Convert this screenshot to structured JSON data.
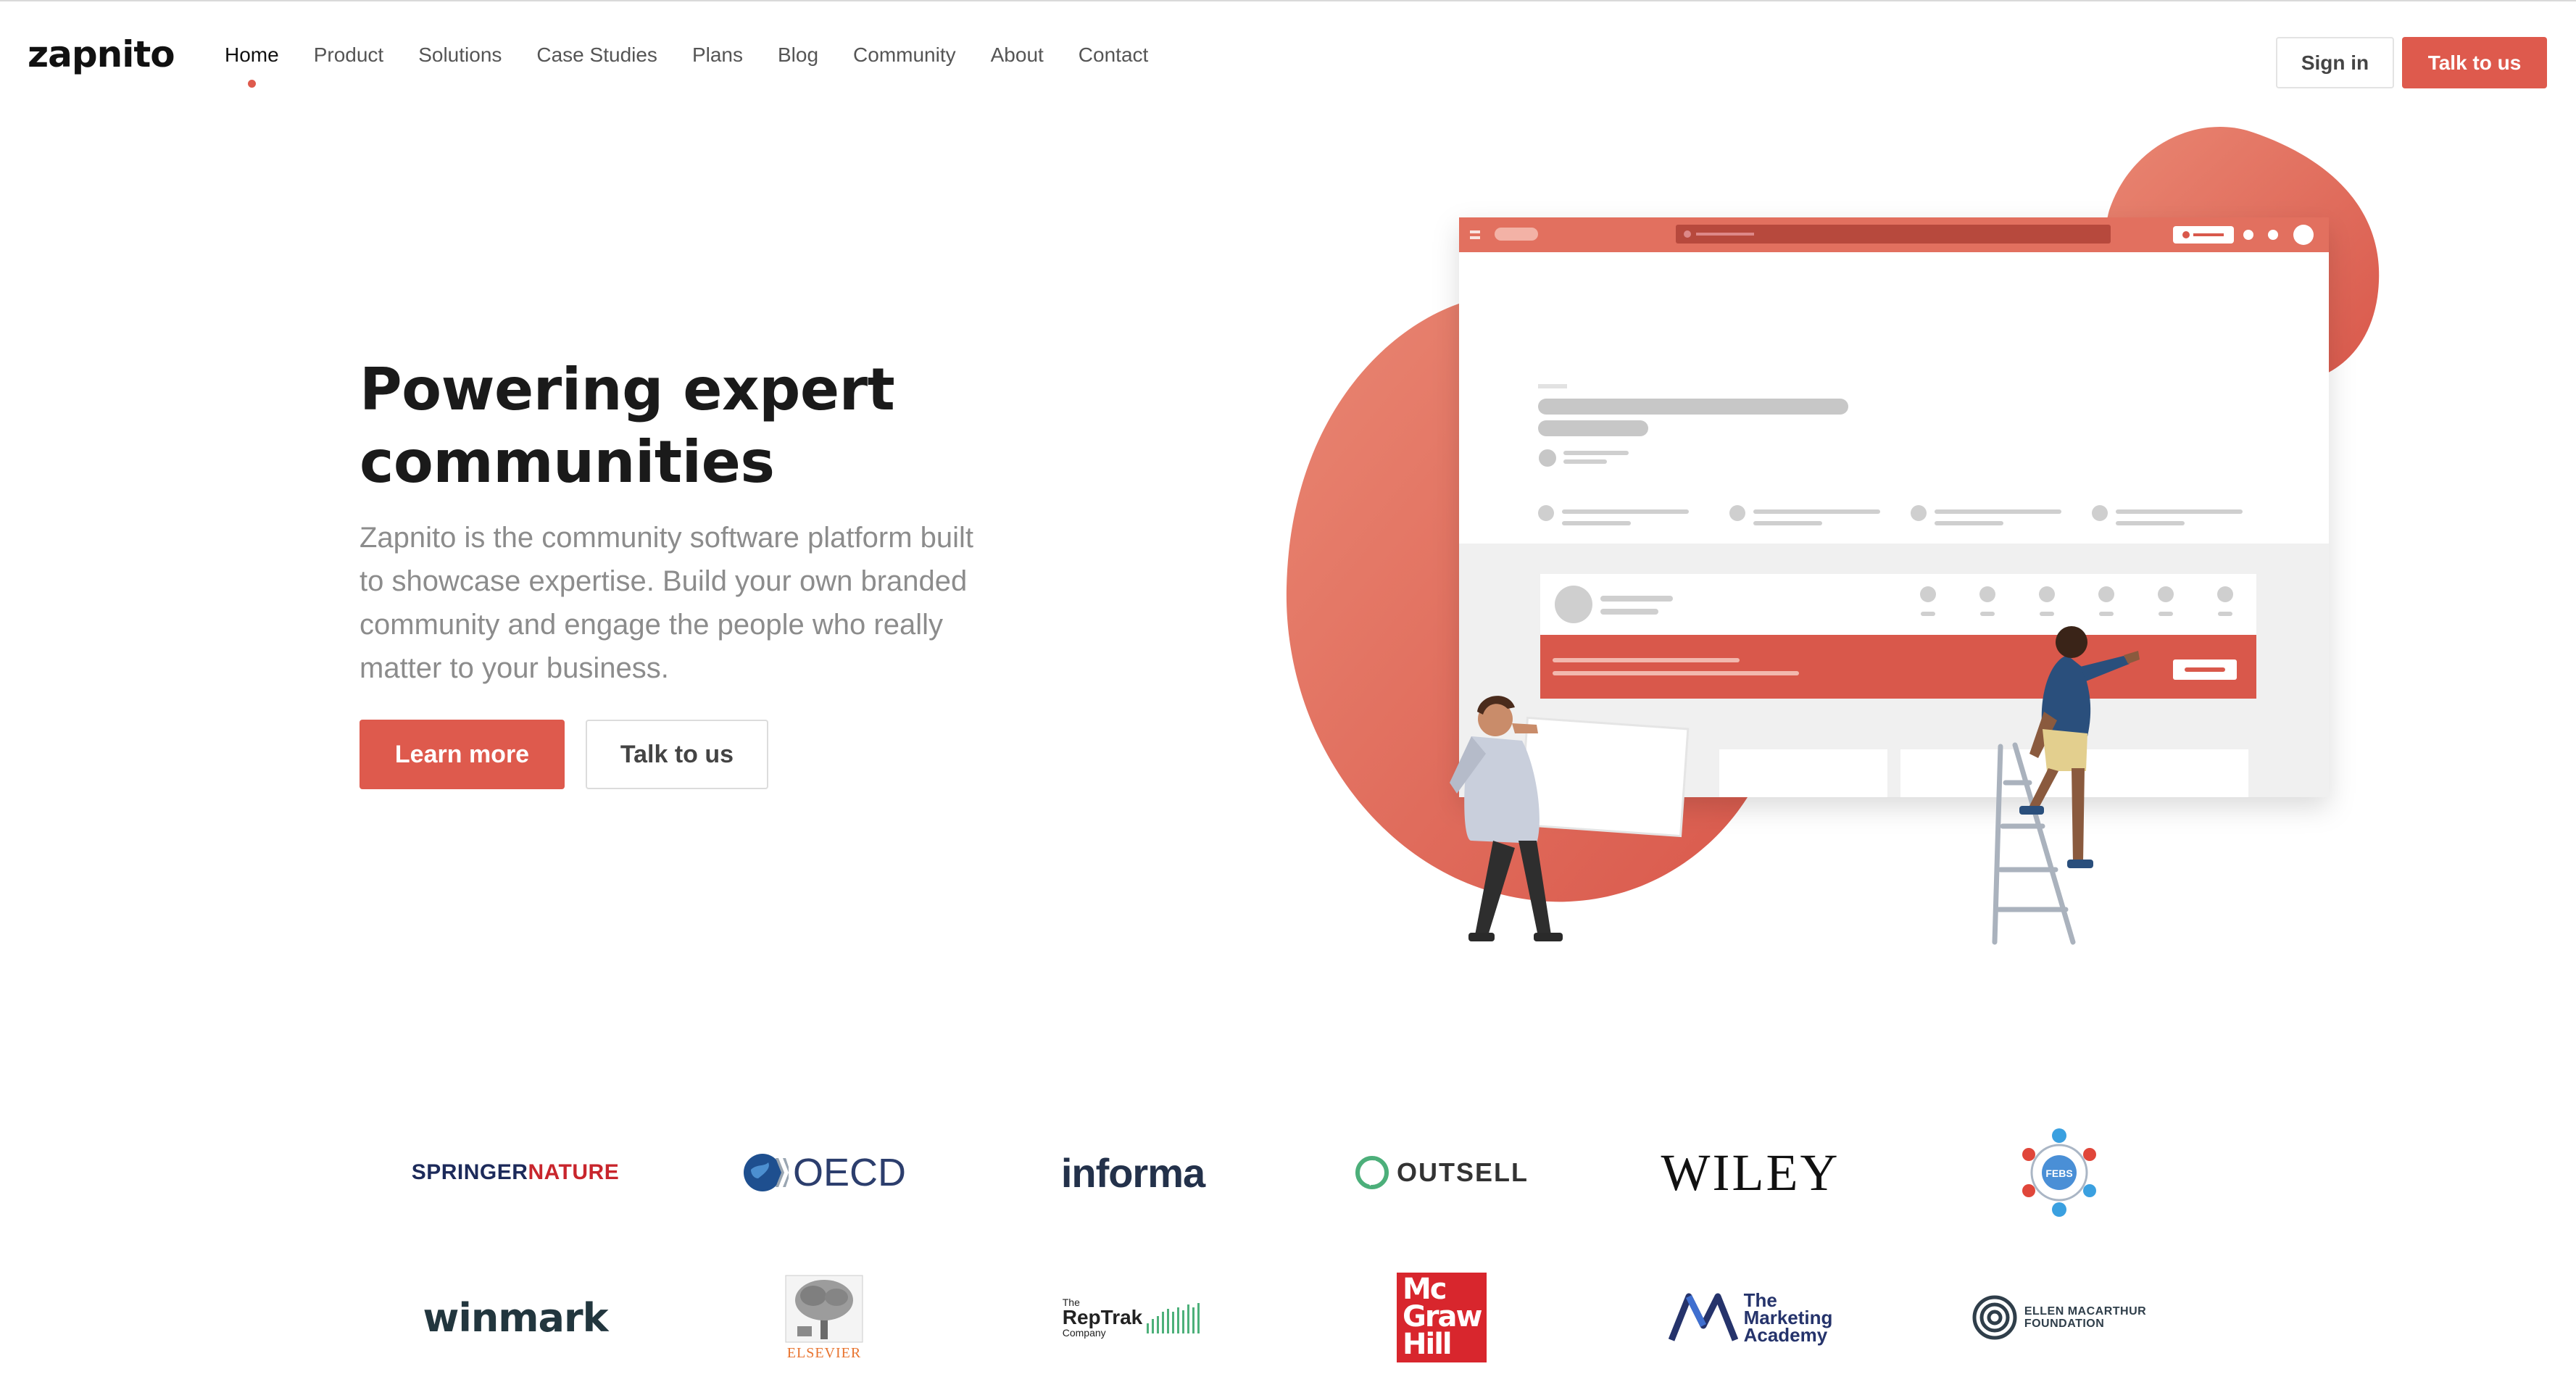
{
  "brand": {
    "logo_text": "zapnito",
    "accent": "#de5a4d"
  },
  "nav": {
    "items": [
      {
        "label": "Home",
        "active": true
      },
      {
        "label": "Product"
      },
      {
        "label": "Solutions"
      },
      {
        "label": "Case Studies"
      },
      {
        "label": "Plans"
      },
      {
        "label": "Blog"
      },
      {
        "label": "Community"
      },
      {
        "label": "About"
      },
      {
        "label": "Contact"
      }
    ],
    "sign_in": "Sign in",
    "talk_to_us": "Talk to us"
  },
  "hero": {
    "title_line1": "Powering expert",
    "title_line2": "communities",
    "description": "Zapnito is the community software platform built to showcase expertise. Build your own branded community and engage the people who really matter to your business.",
    "learn_more": "Learn more",
    "talk_to_us": "Talk to us"
  },
  "logos": {
    "springer_a": "SPRINGER",
    "springer_b": "NATURE",
    "oecd": "OECD",
    "informa": "informa",
    "outsell": "OUTSELL",
    "wiley": "WILEY",
    "febs": "FEBS",
    "winmark": "winmark",
    "elsevier": "ELSEVIER",
    "reptrak_1": "The",
    "reptrak_2": "RepTrak",
    "reptrak_3": "Company",
    "mcgraw_1": "Mc",
    "mcgraw_2": "Graw",
    "mcgraw_3": "Hill",
    "marketing_1": "The",
    "marketing_2": "Marketing",
    "marketing_3": "Academy",
    "emf_1": "ELLEN MACARTHUR",
    "emf_2": "FOUNDATION"
  }
}
